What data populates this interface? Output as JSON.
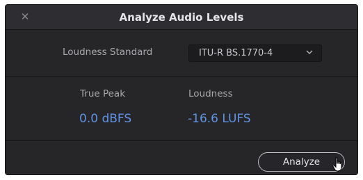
{
  "dialog": {
    "title": "Analyze Audio Levels",
    "close_icon": "close-icon"
  },
  "settings": {
    "standard_label": "Loudness Standard",
    "standard_value": "ITU-R BS.1770-4"
  },
  "results": {
    "true_peak_label": "True Peak",
    "true_peak_value": "0.0 dBFS",
    "loudness_label": "Loudness",
    "loudness_value": "-16.6 LUFS"
  },
  "footer": {
    "analyze_label": "Analyze"
  },
  "colors": {
    "value_blue": "#5f93e6",
    "panel_bg": "#262629"
  }
}
